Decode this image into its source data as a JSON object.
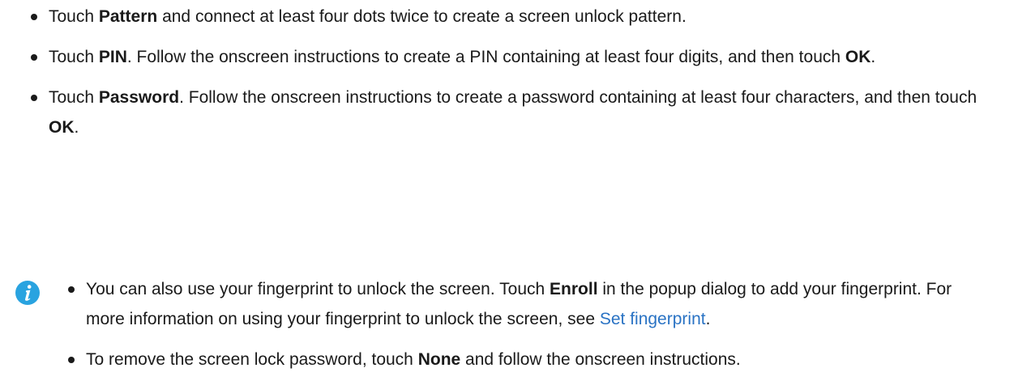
{
  "bullets": [
    {
      "pre": "Touch ",
      "b1": "Pattern",
      "post": " and connect at least four dots twice to create a screen unlock pattern."
    },
    {
      "pre": "Touch ",
      "b1": "PIN",
      "mid": ". Follow the onscreen instructions to create a PIN containing at least four digits, and then touch ",
      "b2": "OK",
      "post": "."
    },
    {
      "pre": "Touch ",
      "b1": "Password",
      "mid": ". Follow the onscreen instructions to create a password containing at least four characters, and then touch ",
      "b2": "OK",
      "post": "."
    }
  ],
  "note": {
    "icon": "info-icon",
    "icon_color": "#29a3e0",
    "link_color": "#2a73c4",
    "items": [
      {
        "pre": "You can also use your fingerprint to unlock the screen. Touch ",
        "b1": "Enroll",
        "mid": " in the popup dialog to add your fingerprint. For more information on using your fingerprint to unlock the screen, see ",
        "link": "Set fingerprint",
        "post": "."
      },
      {
        "pre": "To remove the screen lock password, touch ",
        "b1": "None",
        "post": " and follow the onscreen instructions."
      }
    ]
  }
}
